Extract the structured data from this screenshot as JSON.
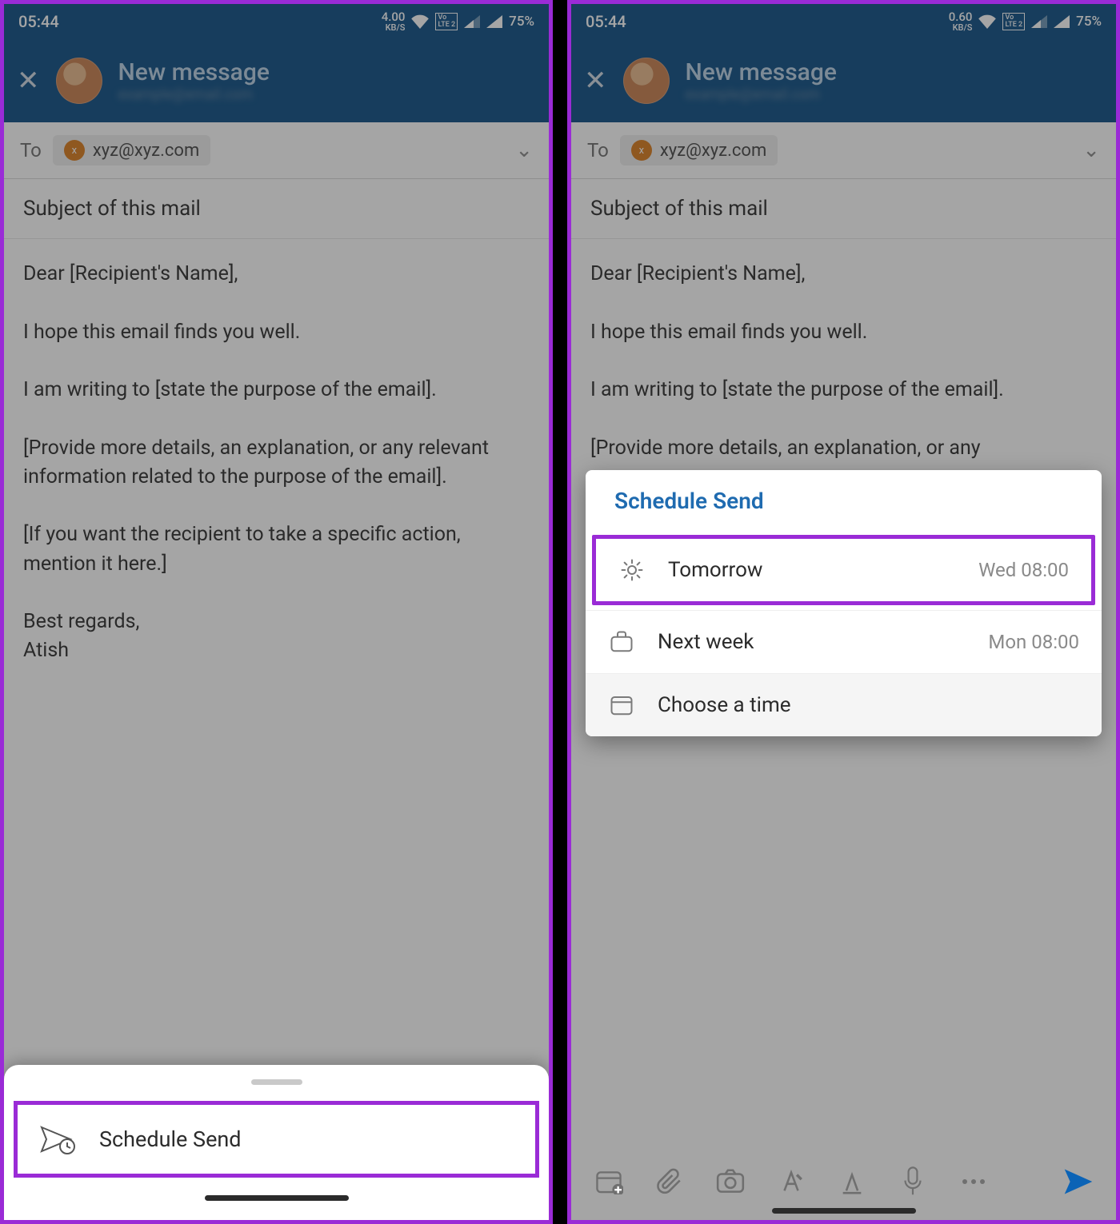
{
  "status": {
    "time": "05:44",
    "kbs_left": "4.00",
    "kbs_right": "0.60",
    "kbs_unit": "KB/S",
    "lte": "LTE 2",
    "vo": "Vo",
    "battery": "75%"
  },
  "header": {
    "title": "New message",
    "subtitle_blur": "example@email.com"
  },
  "compose": {
    "to_label": "To",
    "recipient": "xyz@xyz.com",
    "subject": "Subject of this mail",
    "body": "Dear [Recipient's Name],\n\nI hope this email finds you well.\n\nI am writing to [state the purpose of the email].\n\n[Provide more details, an explanation, or any relevant information related to the purpose of the email].\n\n[If you want the recipient to take a specific action, mention it here.]\n\nBest regards,\nAtish",
    "body_short": "Dear [Recipient's Name],\n\nI hope this email finds you well.\n\nI am writing to [state the purpose of the email].\n\n[Provide more details, an explanation, or any"
  },
  "sheet": {
    "schedule_send": "Schedule Send"
  },
  "popup": {
    "title": "Schedule Send",
    "rows": [
      {
        "icon": "sun-icon",
        "label": "Tomorrow",
        "when": "Wed 08:00"
      },
      {
        "icon": "briefcase-icon",
        "label": "Next week",
        "when": "Mon 08:00"
      },
      {
        "icon": "calendar-icon",
        "label": "Choose a time",
        "when": ""
      }
    ]
  },
  "toolbar_icons": [
    "calendar-plus-icon",
    "attachment-icon",
    "camera-icon",
    "format-icon",
    "mention-icon",
    "mic-icon",
    "more-icon",
    "send-icon"
  ]
}
